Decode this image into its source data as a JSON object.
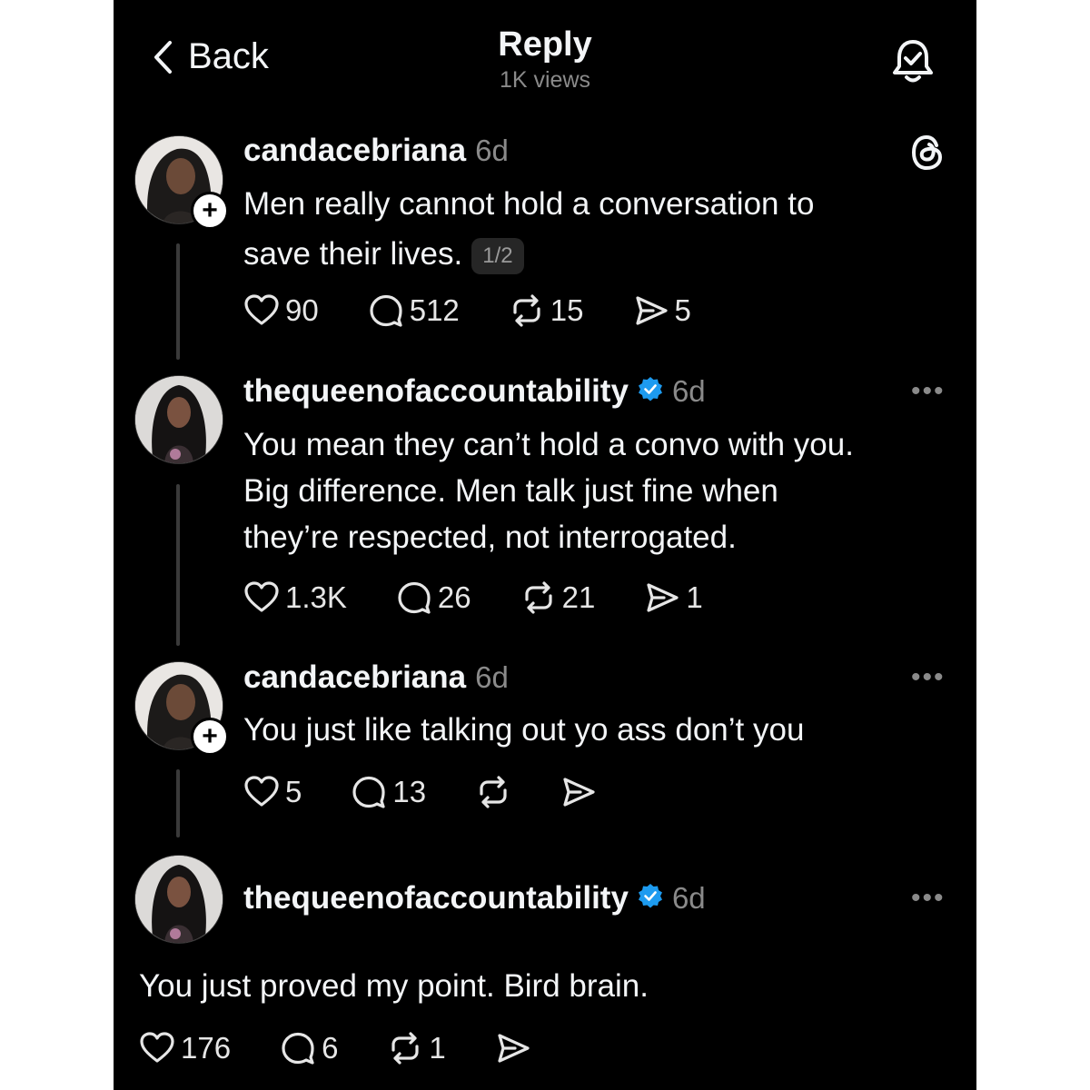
{
  "header": {
    "back_label": "Back",
    "title": "Reply",
    "views": "1K views"
  },
  "posts": [
    {
      "username": "candacebriana",
      "time": "6d",
      "text_line1": "Men really cannot hold a conversation to",
      "text_line2": "save their lives.",
      "thread_index": "1/2",
      "likes": "90",
      "replies": "512",
      "reposts": "15",
      "shares": "5"
    },
    {
      "username": "thequeenofaccountability",
      "time": "6d",
      "text_line1": "You mean they can’t hold a convo with you.",
      "text_line2": "Big difference. Men talk just fine when",
      "text_line3": "they’re respected, not interrogated.",
      "likes": "1.3K",
      "replies": "26",
      "reposts": "21",
      "shares": "1"
    },
    {
      "username": "candacebriana",
      "time": "6d",
      "text_line1": "You just like talking out yo ass don’t you",
      "likes": "5",
      "replies": "13"
    },
    {
      "username": "thequeenofaccountability",
      "time": "6d",
      "text_line1": "You just proved my point. Bird brain.",
      "likes": "176",
      "replies": "6",
      "reposts": "1"
    }
  ],
  "more_label": "•••",
  "plus_label": "+",
  "colors": {
    "background": "#000000",
    "text": "#f3f5f7",
    "muted": "#8a8a8a",
    "verified": "#1d9bf0"
  },
  "icons": [
    "chevron-left-icon",
    "bell-icon",
    "threads-logo-icon",
    "heart-icon",
    "comment-icon",
    "repost-icon",
    "share-icon",
    "verified-badge-icon",
    "more-icon",
    "follow-plus-icon"
  ]
}
